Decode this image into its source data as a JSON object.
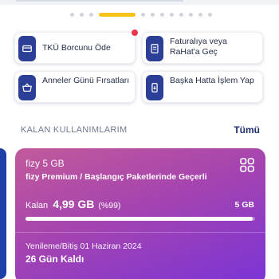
{
  "carousel": {
    "dot_count": 12,
    "active_index": 3
  },
  "quick_actions": [
    {
      "label": "TKÜ Borcunu Öde",
      "icon": "card-icon",
      "notification": true
    },
    {
      "label": "Faturalıya veya RaHat'a Geç",
      "icon": "document-icon",
      "notification": false
    },
    {
      "label": "Anneler Günü Fırsatları",
      "icon": "basket-icon",
      "notification": false
    },
    {
      "label": "Başka Hatta İşlem Yap",
      "icon": "phone-transfer-icon",
      "notification": false
    }
  ],
  "usage_section": {
    "title": "KALAN KULLANIMLARIM",
    "see_all": "Tümü"
  },
  "package": {
    "name": "fizy 5 GB",
    "valid_for": "fizy Premium / Başlangıç Paketlerinde Geçerli",
    "remaining_label": "Kalan",
    "remaining_amount": "4,99 GB",
    "remaining_percent_text": "(%99)",
    "remaining_fraction": 0.99,
    "total": "5 GB",
    "renewal_text": "Yenileme/Bitiş 01 Haziran 2024",
    "days_left": "26 Gün Kaldı"
  },
  "colors": {
    "brand_navy": "#2b3f96",
    "accent_yellow": "#f7c31a",
    "notification_red": "#e8374e",
    "package_gradient_start": "#c25a9a",
    "package_gradient_end": "#7a34d6"
  }
}
